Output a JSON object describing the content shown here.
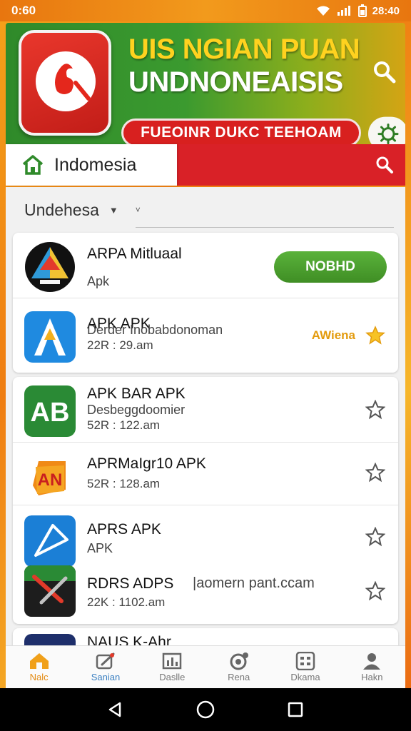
{
  "status_bar": {
    "time": "0:60",
    "clock": "28:40"
  },
  "banner": {
    "title_line1": "UIS NGIAN PUAN",
    "title_line2": "UNDNONEAISIS",
    "pill_label": "FUEOINR DUKC TEEHOAM"
  },
  "location": {
    "label": "Indomesia"
  },
  "filter": {
    "label": "Undehesa"
  },
  "apps": [
    {
      "title": "ARPA Mitluaal",
      "line2": "Apk",
      "line3": "",
      "action": "NOBHD"
    },
    {
      "title": "APK APK",
      "line2": "Derder Inobabdonoman",
      "line3": "22R : 29.am",
      "action": "AWiena"
    },
    {
      "title": "APK BAR APK",
      "line2": "Desbeggdoomier",
      "line3": "52R : 122.am"
    },
    {
      "title": "APRMaIgr10 APK",
      "line2": "",
      "line3": "52R : 128.am"
    },
    {
      "title": "APRS APK",
      "line2": "APK",
      "line3": ""
    },
    {
      "title": "RDRS ADPS",
      "line2": "|aomern pant.ccam",
      "line3": "22K : 1102.am"
    },
    {
      "title": "NAUS K-Ahr"
    }
  ],
  "bottom_nav": [
    {
      "label": "Nalc",
      "icon": "home-icon"
    },
    {
      "label": "Sanian",
      "icon": "edit-icon"
    },
    {
      "label": "Daslle",
      "icon": "chart-icon"
    },
    {
      "label": "Rena",
      "icon": "target-icon"
    },
    {
      "label": "Dkama",
      "icon": "grid-icon"
    },
    {
      "label": "Hakn",
      "icon": "person-icon"
    }
  ],
  "colors": {
    "brand_green": "#3b9a2f",
    "brand_red": "#d92127",
    "accent_orange": "#e38a10",
    "title_yellow": "#ffd21f"
  }
}
